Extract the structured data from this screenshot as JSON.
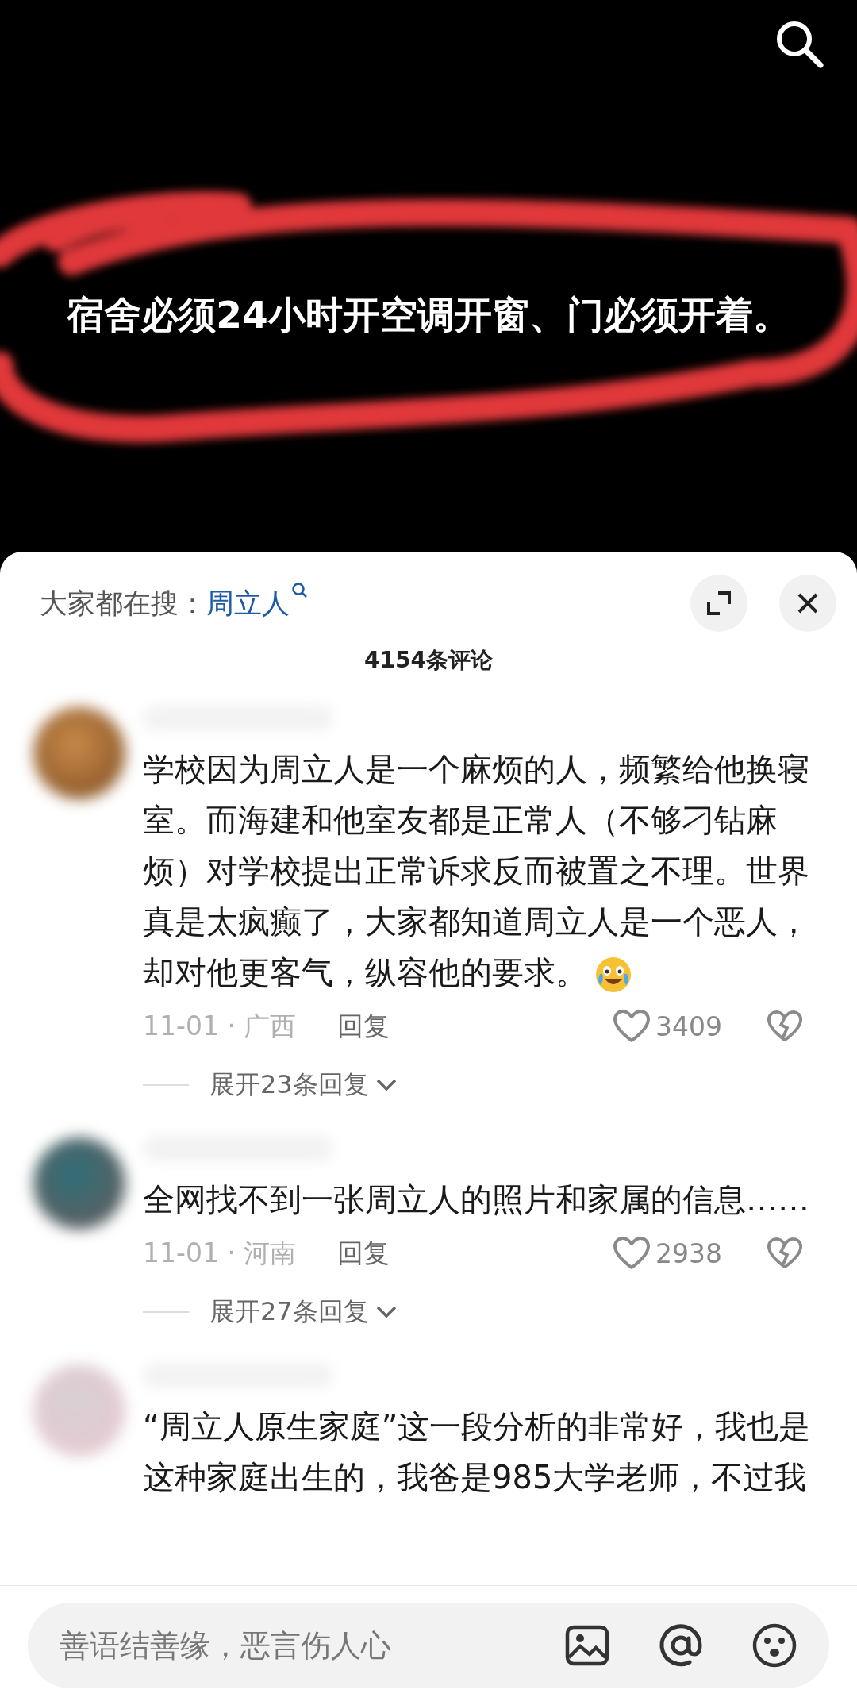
{
  "video": {
    "caption": "宿舍必须24小时开空调开窗、门必须开着。"
  },
  "trending": {
    "label": "大家都在搜：",
    "term": "周立人"
  },
  "comment_count": "4154条评论",
  "comments": [
    {
      "text": "学校因为周立人是一个麻烦的人，频繁给他换寝室。而海建和他室友都是正常人（不够刁钻麻烦）对学校提出正常诉求反而被置之不理。世界真是太疯癫了，大家都知道周立人是一个恶人，却对他更客气，纵容他的要求。",
      "emoji": true,
      "meta": "11-01 · 广西",
      "reply": "回复",
      "likes": "3409",
      "expand": "展开23条回复"
    },
    {
      "text": "全网找不到一张周立人的照片和家属的信息……",
      "emoji": false,
      "meta": "11-01 · 河南",
      "reply": "回复",
      "likes": "2938",
      "expand": "展开27条回复"
    },
    {
      "text": "“周立人原生家庭”这一段分析的非常好，我也是这种家庭出生的，我爸是985大学老师，不过我",
      "emoji": false
    }
  ],
  "input": {
    "placeholder": "善语结善缘，恶言伤人心"
  }
}
